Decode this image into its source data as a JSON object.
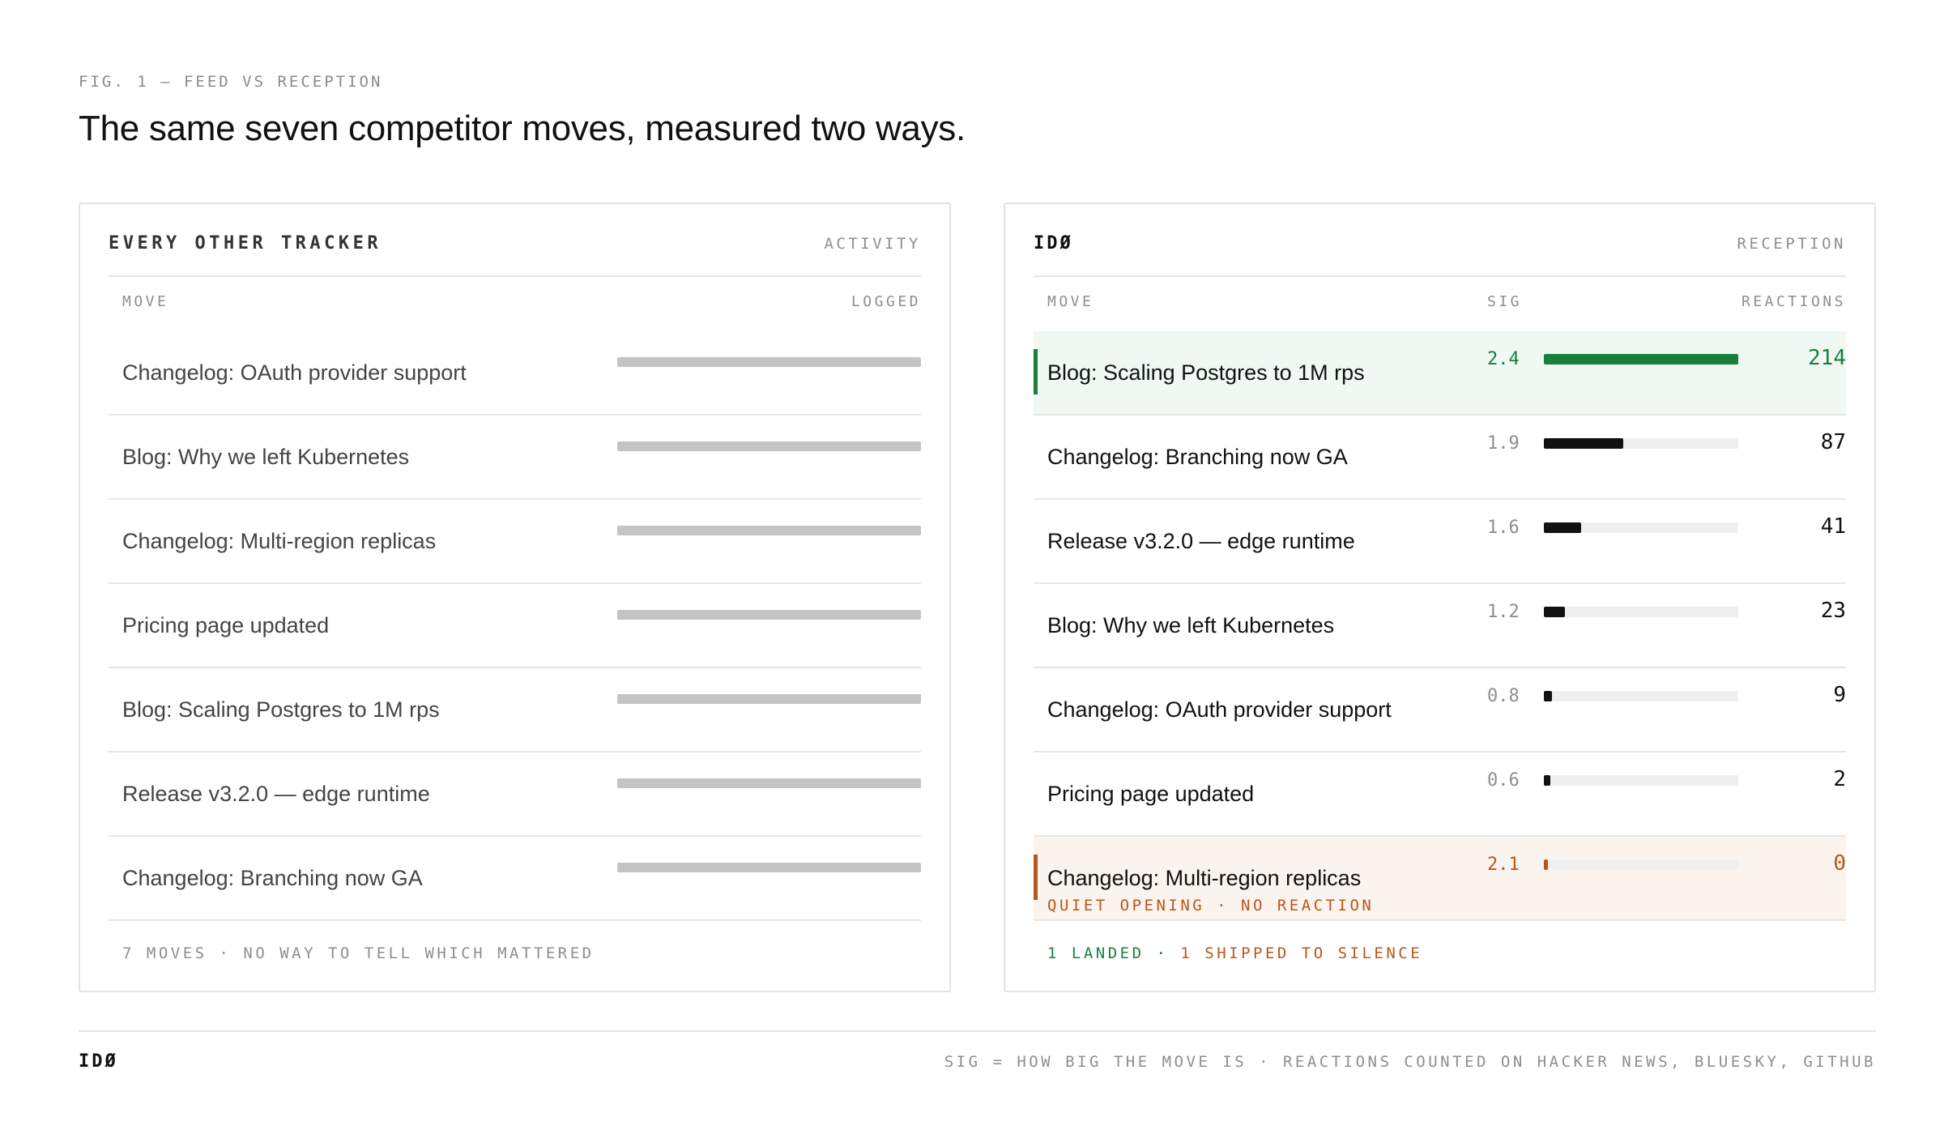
{
  "figure": {
    "label": "FIG. 1 — FEED VS RECEPTION",
    "title": "The same seven competitor moves, measured two ways."
  },
  "left_panel": {
    "title": "EVERY OTHER TRACKER",
    "tag": "ACTIVITY",
    "col_move": "MOVE",
    "col_logged": "LOGGED",
    "rows": [
      {
        "move": "Changelog: OAuth provider support",
        "logged": 1
      },
      {
        "move": "Blog: Why we left Kubernetes",
        "logged": 1
      },
      {
        "move": "Changelog: Multi-region replicas",
        "logged": 1
      },
      {
        "move": "Pricing page updated",
        "logged": 1
      },
      {
        "move": "Blog: Scaling Postgres to 1M rps",
        "logged": 1
      },
      {
        "move": "Release v3.2.0 — edge runtime",
        "logged": 1
      },
      {
        "move": "Changelog: Branching now GA",
        "logged": 1
      }
    ],
    "footer": "7 MOVES · NO WAY TO TELL WHICH MATTERED"
  },
  "right_panel": {
    "title": "IDØ",
    "tag": "RECEPTION",
    "col_move": "MOVE",
    "col_sig": "SIG",
    "col_reactions": "REACTIONS",
    "rows": [
      {
        "move": "Blog: Scaling Postgres to 1M rps",
        "sig": "2.4",
        "reactions": 214,
        "status": "landed",
        "note": ""
      },
      {
        "move": "Changelog: Branching now GA",
        "sig": "1.9",
        "reactions": 87,
        "status": "normal",
        "note": ""
      },
      {
        "move": "Release v3.2.0 — edge runtime",
        "sig": "1.6",
        "reactions": 41,
        "status": "normal",
        "note": ""
      },
      {
        "move": "Blog: Why we left Kubernetes",
        "sig": "1.2",
        "reactions": 23,
        "status": "normal",
        "note": ""
      },
      {
        "move": "Changelog: OAuth provider support",
        "sig": "0.8",
        "reactions": 9,
        "status": "normal",
        "note": ""
      },
      {
        "move": "Pricing page updated",
        "sig": "0.6",
        "reactions": 2,
        "status": "normal",
        "note": ""
      },
      {
        "move": "Changelog: Multi-region replicas",
        "sig": "2.1",
        "reactions": 0,
        "status": "silent",
        "note": "QUIET OPENING · NO REACTION"
      }
    ],
    "footer_landed": "1 LANDED",
    "footer_sep": "·",
    "footer_silent": "1 SHIPPED TO SILENCE"
  },
  "footer": {
    "brand": "IDØ",
    "note": "SIG = HOW BIG THE MOVE IS · REACTIONS COUNTED ON HACKER NEWS, BLUESKY, GITHUB"
  },
  "colors": {
    "landed": "#1a7f3c",
    "silent": "#b8571c",
    "bar": "#111111",
    "logged_bar": "#c4c4c4",
    "track": "#efefef"
  }
}
